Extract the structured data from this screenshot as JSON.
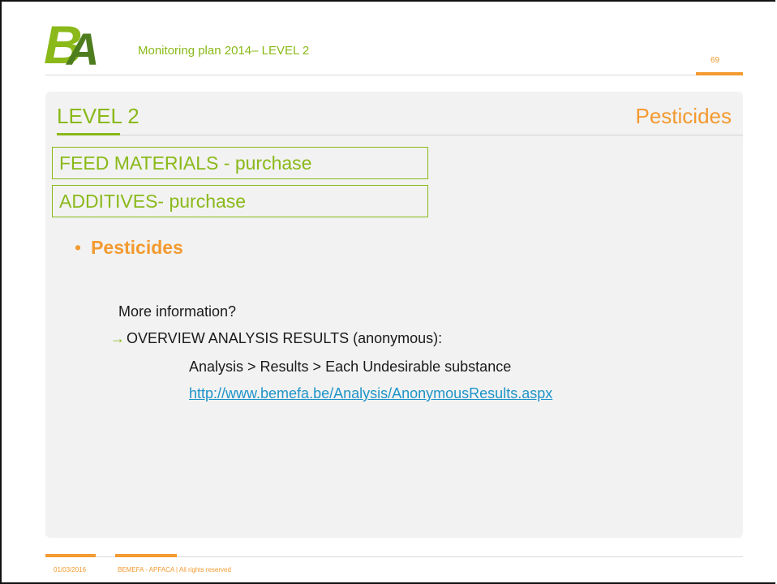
{
  "header": {
    "logo_text": "BA",
    "title": "Monitoring plan 2014– LEVEL 2",
    "page_number": "69"
  },
  "slide": {
    "level_title": "LEVEL 2",
    "section_title": "Pesticides",
    "boxes": [
      "FEED MATERIALS - purchase",
      "ADDITIVES- purchase"
    ],
    "bullet": "Pesticides",
    "more_info": "More information?",
    "overview": "OVERVIEW ANALYSIS RESULTS (anonymous):",
    "path": "Analysis > Results > Each Undesirable substance",
    "link": "http://www.bemefa.be/Analysis/AnonymousResults.aspx"
  },
  "footer": {
    "date": "01/03/2016",
    "copyright": "BEMEFA - APFACA  |  All rights reserved"
  },
  "colors": {
    "brand_green": "#8ab919",
    "brand_dark_green": "#4e7d1e",
    "accent_orange": "#f39a30",
    "link_blue": "#1f94c8"
  }
}
